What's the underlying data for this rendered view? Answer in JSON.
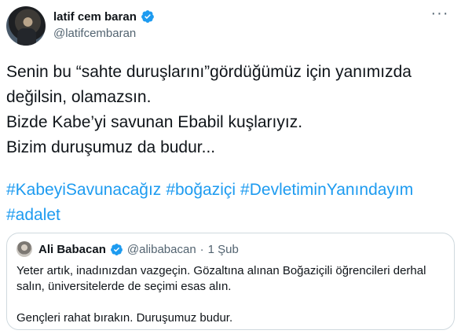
{
  "author": {
    "display_name": "latif cem baran",
    "handle": "@latifcembaran"
  },
  "more_menu": "···",
  "tweet": {
    "lines": [
      "Senin bu “sahte duruşlarını”gördüğümüz için yanımızda",
      "değilsin, olamazsın.",
      "Bizde Kabe’yi savunan Ebabil kuşlarıyız.",
      "Bizim duruşumuz da budur..."
    ],
    "hashtags": [
      "#KabeyiSavunacağız",
      "#boğaziçi",
      "#DevletiminYanındayım",
      "#adalet"
    ]
  },
  "quoted_tweet": {
    "display_name": "Ali Babacan",
    "handle": "@alibabacan",
    "separator": "·",
    "date": "1 Şub",
    "lines": [
      "Yeter artık, inadınızdan vazgeçin. Gözaltına alınan Boğaziçili öğrencileri derhal",
      "salın, üniversitelerde de seçimi esas alın.",
      "Gençleri rahat bırakın. Duruşumuz budur."
    ]
  },
  "colors": {
    "link": "#1d9bf0",
    "verified": "#1d9bf0",
    "secondary_text": "#536471",
    "border": "#cfd9de"
  },
  "icons": [
    "verified-badge-icon",
    "more-options-icon"
  ]
}
